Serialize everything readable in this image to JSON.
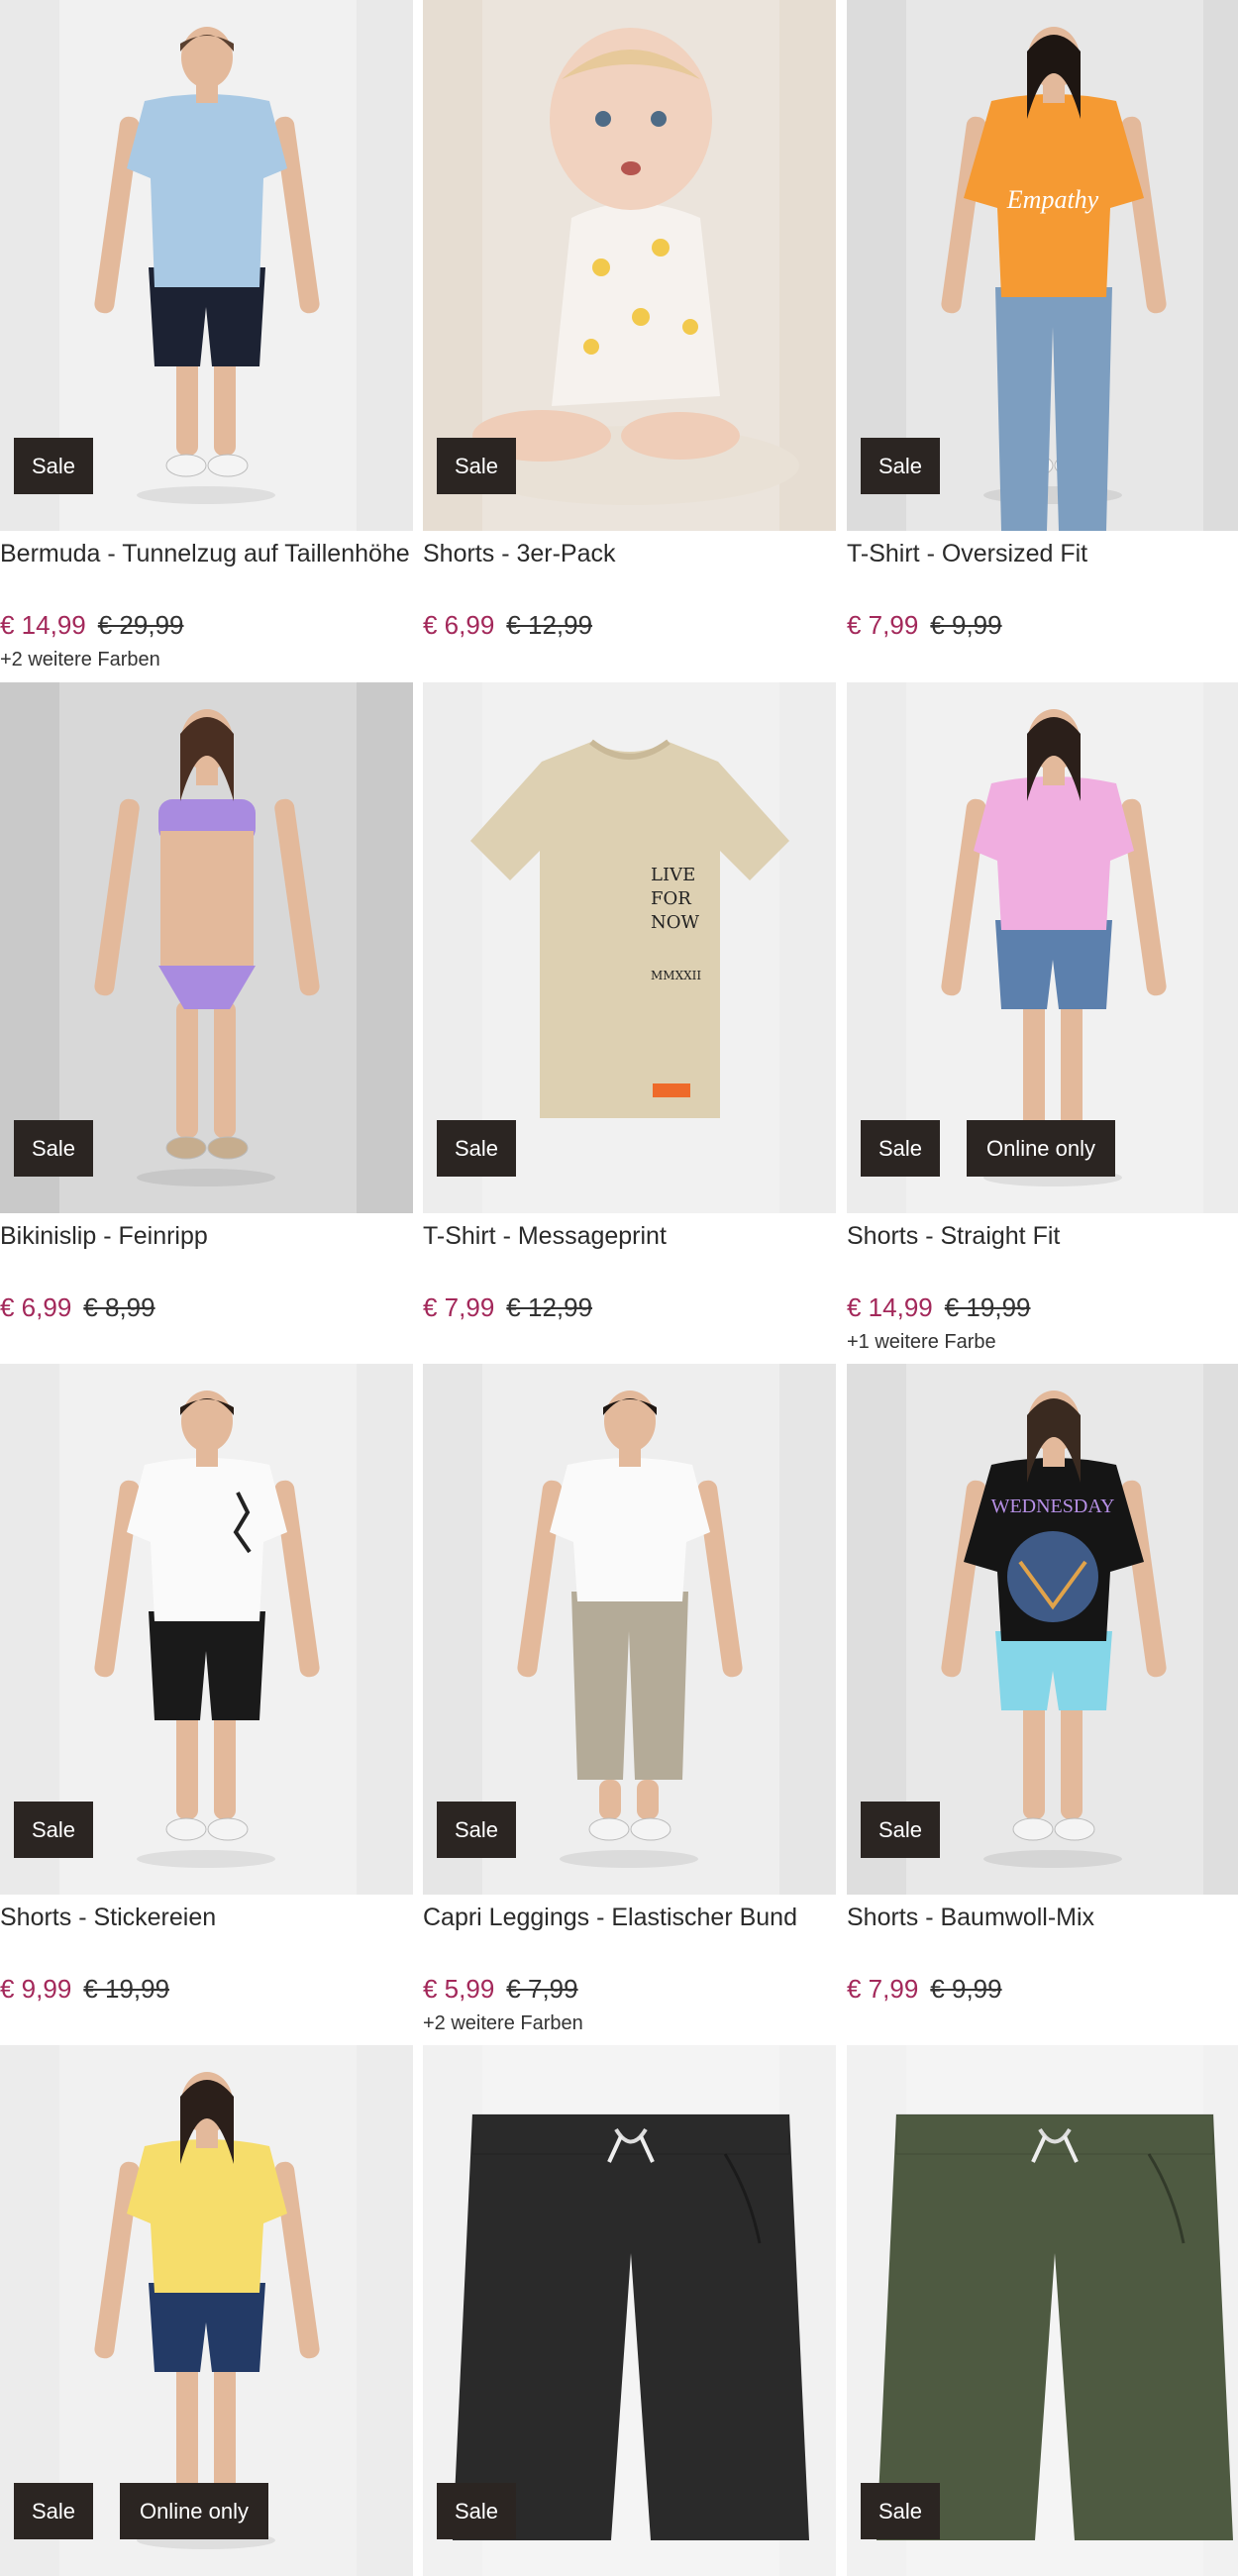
{
  "colors": {
    "sale_bg": "#2b2522",
    "price_accent": "#a3285a",
    "card_bg": "#eceaea"
  },
  "products": [
    {
      "title": "Bermuda - Tunnelzug auf Taillenhöhe",
      "price": "€ 14,99",
      "old_price": "€ 29,99",
      "more_colors": "+2 weitere Farben",
      "badges": [
        "Sale"
      ],
      "image": "man-blue-shirt-navy-cargo-shorts"
    },
    {
      "title": "Shorts - 3er-Pack",
      "price": "€ 6,99",
      "old_price": "€ 12,99",
      "more_colors": "",
      "badges": [
        "Sale"
      ],
      "image": "baby-in-floral-romper"
    },
    {
      "title": "T-Shirt - Oversized Fit",
      "price": "€ 7,99",
      "old_price": "€ 9,99",
      "more_colors": "",
      "badges": [
        "Sale"
      ],
      "image": "woman-orange-oversized-tshirt"
    },
    {
      "title": "Bikinislip - Feinripp",
      "price": "€ 6,99",
      "old_price": "€ 8,99",
      "more_colors": "",
      "badges": [
        "Sale"
      ],
      "image": "woman-lilac-bikini"
    },
    {
      "title": "T-Shirt - Messageprint",
      "price": "€ 7,99",
      "old_price": "€ 12,99",
      "more_colors": "",
      "badges": [
        "Sale"
      ],
      "image": "beige-tshirt-live-for-now-print"
    },
    {
      "title": "Shorts - Straight Fit",
      "price": "€ 14,99",
      "old_price": "€ 19,99",
      "more_colors": "+1 weitere Farbe",
      "badges": [
        "Sale",
        "Online only"
      ],
      "image": "woman-pink-tee-denim-shorts"
    },
    {
      "title": "Shorts - Stickereien",
      "price": "€ 9,99",
      "old_price": "€ 19,99",
      "more_colors": "",
      "badges": [
        "Sale"
      ],
      "image": "man-white-tee-black-cargo-shorts"
    },
    {
      "title": "Capri Leggings - Elastischer Bund",
      "price": "€ 5,99",
      "old_price": "€ 7,99",
      "more_colors": "+2 weitere Farben",
      "badges": [
        "Sale"
      ],
      "image": "woman-white-tee-beige-capri-leggings"
    },
    {
      "title": "Shorts - Baumwoll-Mix",
      "price": "€ 7,99",
      "old_price": "€ 9,99",
      "more_colors": "",
      "badges": [
        "Sale"
      ],
      "image": "woman-wednesday-tee-turquoise-shorts"
    },
    {
      "title": "",
      "price": "",
      "old_price": "",
      "more_colors": "",
      "badges": [
        "Sale",
        "Online only"
      ],
      "image": "woman-yellow-tee-denim-shorts"
    },
    {
      "title": "",
      "price": "",
      "old_price": "",
      "more_colors": "",
      "badges": [
        "Sale"
      ],
      "image": "black-drawstring-shorts"
    },
    {
      "title": "",
      "price": "",
      "old_price": "",
      "more_colors": "",
      "badges": [
        "Sale"
      ],
      "image": "olive-drawstring-shorts"
    }
  ]
}
